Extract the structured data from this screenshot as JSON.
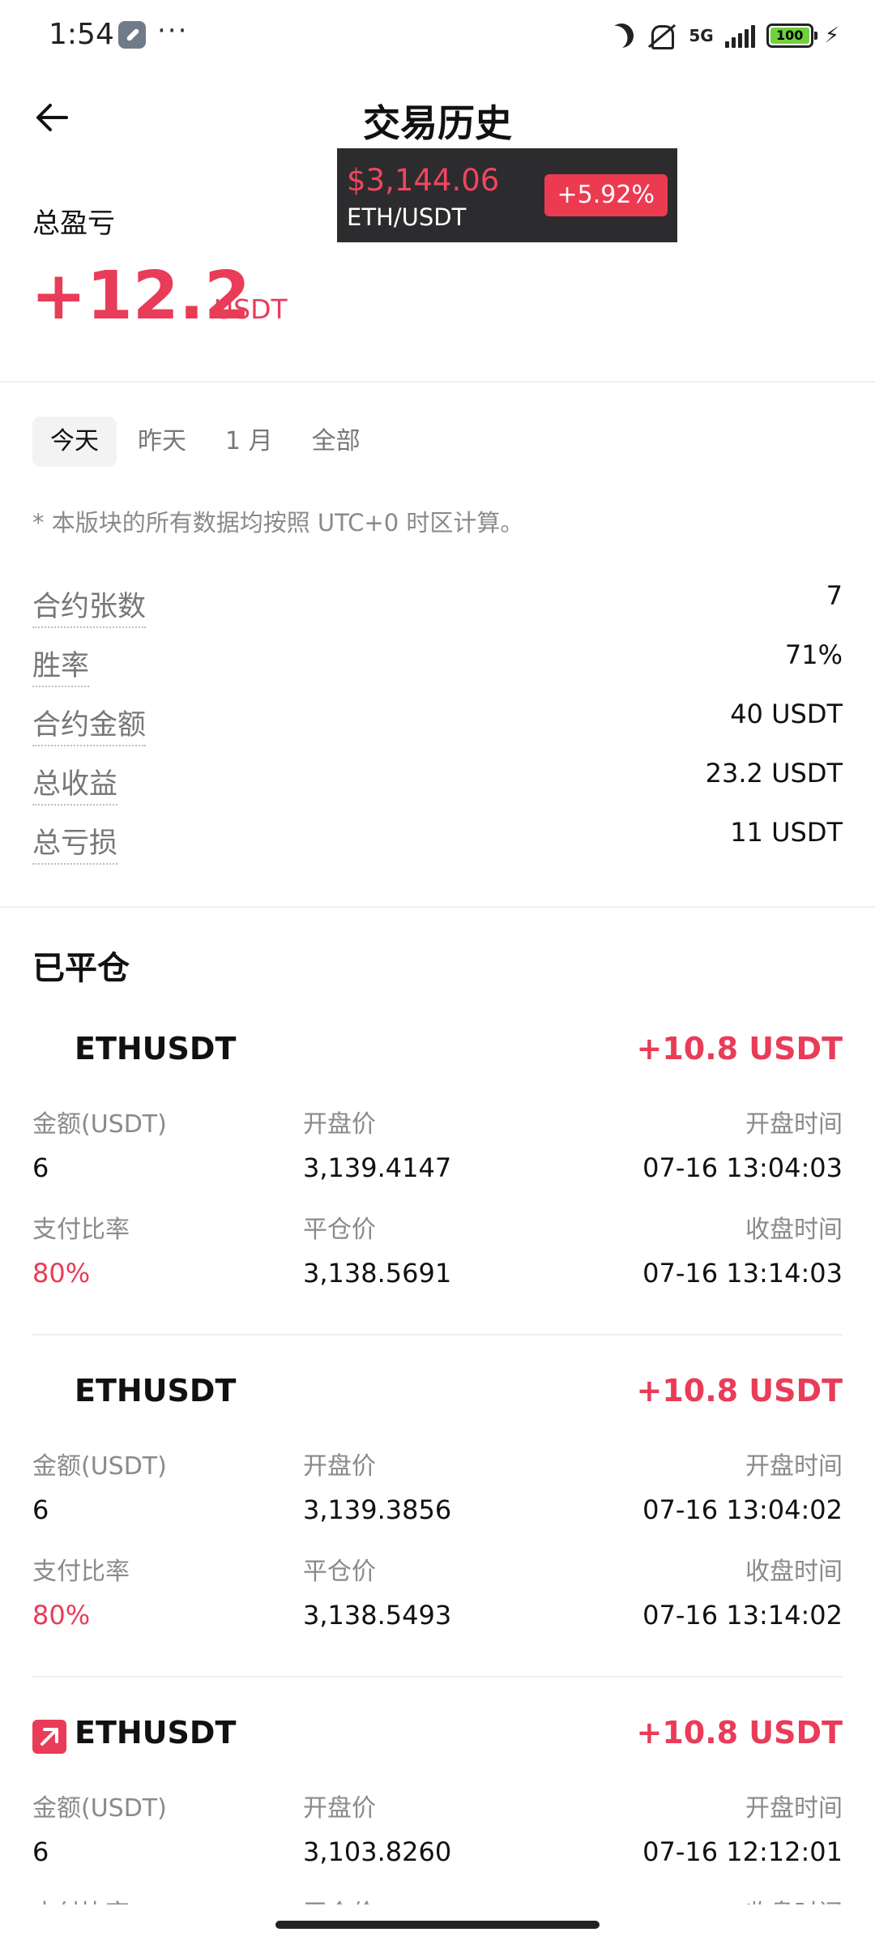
{
  "status_bar": {
    "time": "1:54",
    "dots": "···",
    "network": "5G",
    "battery": "100",
    "icons": [
      "wrench-icon",
      "moon-icon",
      "mute-icon",
      "signal-icon",
      "battery-icon",
      "charging-icon"
    ]
  },
  "header": {
    "title": "交易历史",
    "back_icon": "back-arrow-icon"
  },
  "ticker": {
    "price": "$3,144.06",
    "pair": "ETH/USDT",
    "change": "+5.92%"
  },
  "pnl": {
    "label": "总盈亏",
    "value": "+12.2",
    "unit": "USDT"
  },
  "tabs": [
    "今天",
    "昨天",
    "1 月",
    "全部"
  ],
  "active_tab": "今天",
  "note": "* 本版块的所有数据均按照 UTC+0 时区计算。",
  "stats": [
    {
      "label": "合约张数",
      "value": "7"
    },
    {
      "label": "胜率",
      "value": "71%"
    },
    {
      "label": "合约金额",
      "value": "40 USDT"
    },
    {
      "label": "总收益",
      "value": "23.2 USDT"
    },
    {
      "label": "总亏损",
      "value": "11 USDT"
    }
  ],
  "closed": {
    "title": "已平仓",
    "labels": {
      "amount": "金额(USDT)",
      "open_price": "开盘价",
      "open_time": "开盘时间",
      "payout_rate": "支付比率",
      "close_price": "平仓价",
      "close_time": "收盘时间"
    },
    "trades": [
      {
        "symbol": "ETHUSDT",
        "pnl": "+10.8 USDT",
        "amount": "6",
        "open_price": "3,139.4147",
        "open_time": "07-16 13:04:03",
        "payout_rate": "80%",
        "close_price": "3,138.5691",
        "close_time": "07-16 13:14:03"
      },
      {
        "symbol": "ETHUSDT",
        "pnl": "+10.8 USDT",
        "amount": "6",
        "open_price": "3,139.3856",
        "open_time": "07-16 13:04:02",
        "payout_rate": "80%",
        "close_price": "3,138.5493",
        "close_time": "07-16 13:14:02"
      },
      {
        "symbol": "ETHUSDT",
        "pnl": "+10.8 USDT",
        "amount": "6",
        "open_price": "3,103.8260",
        "open_time": "07-16 12:12:01",
        "payout_rate": "",
        "close_price": "",
        "close_time": ""
      }
    ]
  },
  "colors": {
    "accent_red": "#e93c58",
    "ticker_bg": "#2c2c2e",
    "muted_text": "#8a8a8a"
  }
}
